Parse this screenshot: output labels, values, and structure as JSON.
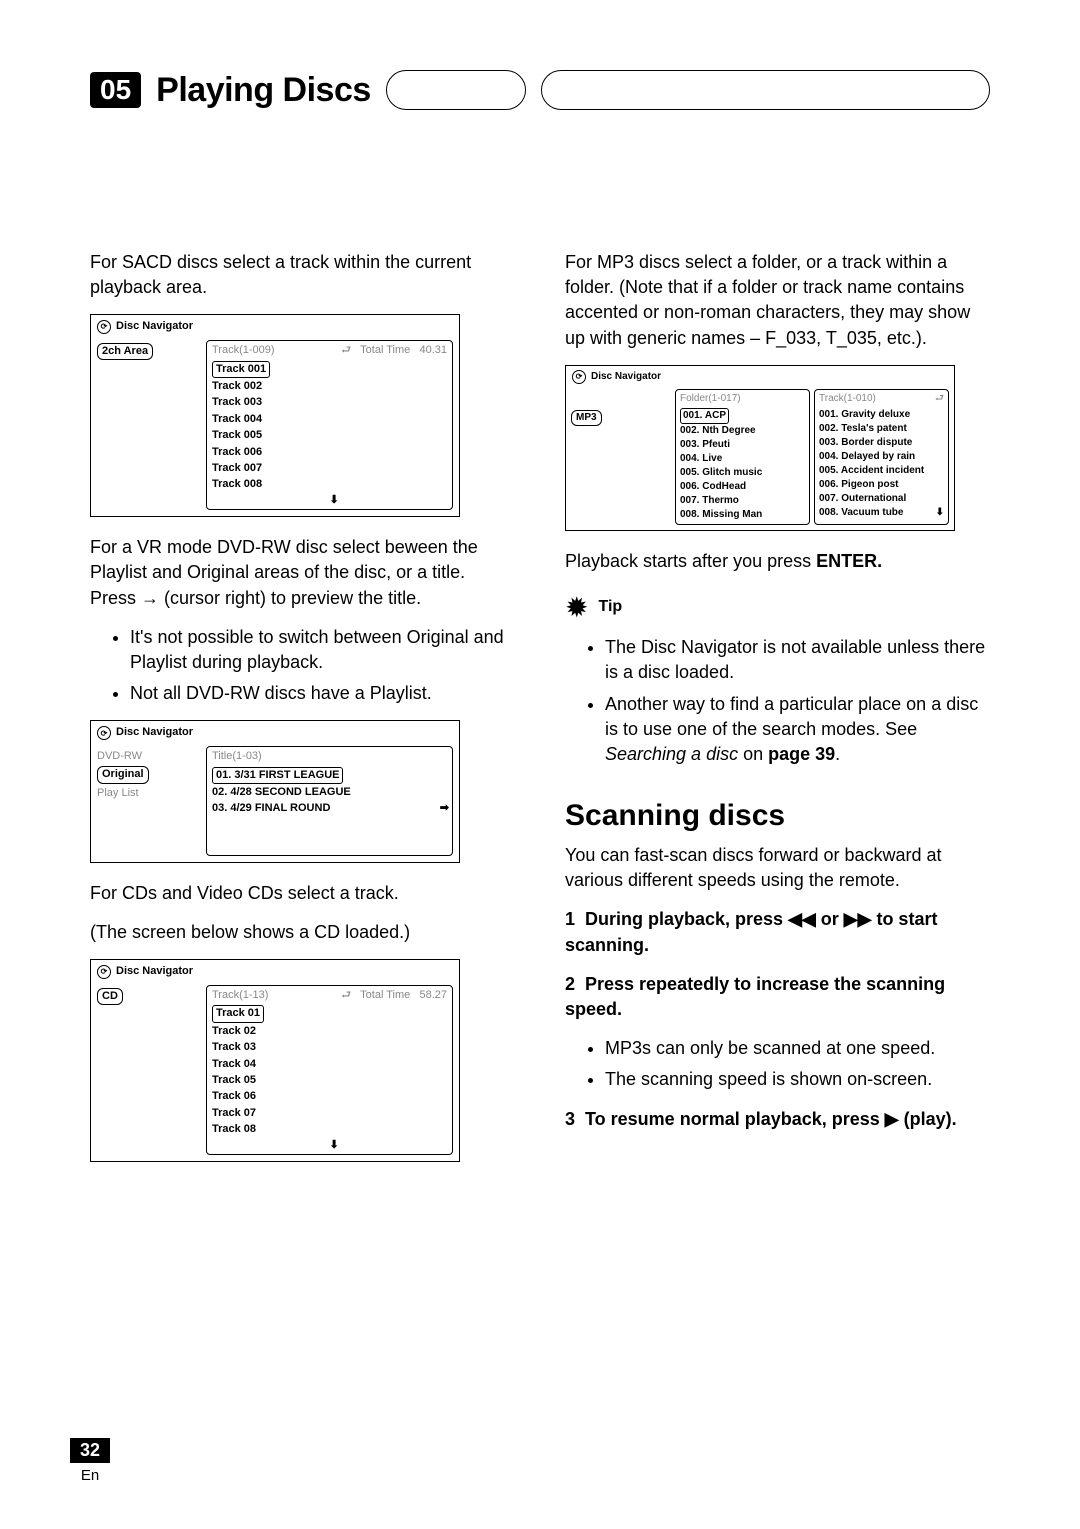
{
  "chapter": {
    "number": "05",
    "title": "Playing Discs"
  },
  "left": {
    "p1": "For SACD discs select a track within the current playback area.",
    "nav1": {
      "title": "Disc Navigator",
      "side": "2ch Area",
      "header_left": "Track(1-009)",
      "header_right_label": "Total Time",
      "header_right_value": "40.31",
      "tracks": [
        "Track 001",
        "Track 002",
        "Track 003",
        "Track 004",
        "Track 005",
        "Track 006",
        "Track 007",
        "Track 008"
      ]
    },
    "p2": "For a VR mode DVD-RW disc select beween the Playlist and Original areas of the disc, or a title. Press → (cursor right) to preview the title.",
    "bullets1": [
      "It's not possible to switch between Original and Playlist during playback.",
      "Not all DVD-RW discs have a Playlist."
    ],
    "nav2": {
      "title": "Disc Navigator",
      "side_label": "DVD-RW",
      "side_items": [
        "Original",
        "Play List"
      ],
      "header": "Title(1-03)",
      "items": [
        "01. 3/31 FIRST LEAGUE",
        "02. 4/28 SECOND LEAGUE",
        "03. 4/29 FINAL ROUND"
      ]
    },
    "p3": "For CDs and Video CDs select a track.",
    "p4": "(The screen below shows a CD loaded.)",
    "nav3": {
      "title": "Disc Navigator",
      "side": "CD",
      "header_left": "Track(1-13)",
      "header_right_label": "Total Time",
      "header_right_value": "58.27",
      "tracks": [
        "Track 01",
        "Track 02",
        "Track 03",
        "Track 04",
        "Track 05",
        "Track 06",
        "Track 07",
        "Track 08"
      ]
    }
  },
  "right": {
    "p1": "For MP3 discs select a folder, or a track within a folder. (Note that if a folder or track name contains accented or non-roman characters, they may show up with generic names – F_033, T_035, etc.).",
    "navmp3": {
      "title": "Disc Navigator",
      "side": "MP3",
      "folder_header": "Folder(1-017)",
      "track_header": "Track(1-010)",
      "folders": [
        "001. ACP",
        "002. Nth Degree",
        "003. Pfeuti",
        "004. Live",
        "005. Glitch music",
        "006. CodHead",
        "007. Thermo",
        "008. Missing Man"
      ],
      "tracks": [
        "001. Gravity deluxe",
        "002. Tesla's patent",
        "003. Border dispute",
        "004. Delayed by rain",
        "005. Accident incident",
        "006. Pigeon post",
        "007. Outernational",
        "008. Vacuum tube"
      ]
    },
    "p2a": "Playback starts after you press ",
    "p2b": "ENTER.",
    "tip_label": "Tip",
    "tips": {
      "t1": "The Disc Navigator is not available unless there is a disc loaded.",
      "t2a": "Another way to find a particular place on a disc is to use one of the search modes. See ",
      "t2b": "Searching a disc",
      "t2c": " on ",
      "t2d": "page 39",
      "t2e": "."
    },
    "scan_heading": "Scanning discs",
    "scan_intro": "You can fast-scan discs forward or backward at various different speeds using the remote.",
    "steps": {
      "s1": "During playback, press ◀◀ or ▶▶ to start scanning.",
      "s2": "Press repeatedly to increase the scanning speed.",
      "s2_bullets": [
        "MP3s can only be scanned at one speed.",
        "The scanning speed is shown on-screen."
      ],
      "s3": "To resume normal playback, press ▶ (play)."
    }
  },
  "footer": {
    "page": "32",
    "lang": "En"
  }
}
